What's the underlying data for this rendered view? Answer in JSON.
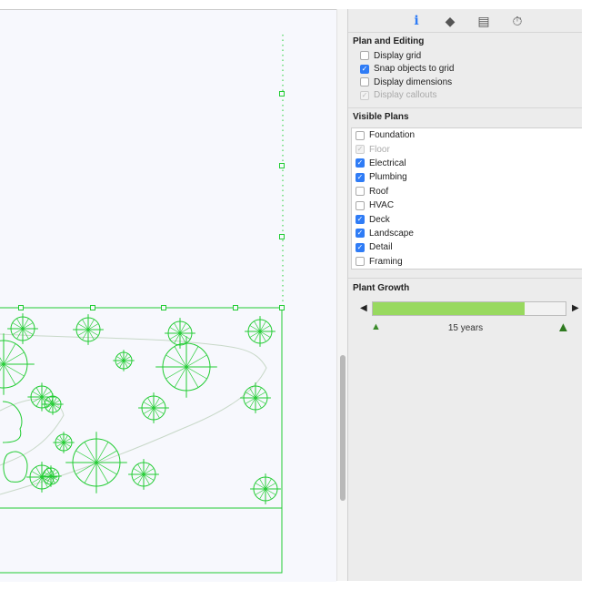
{
  "toolbar": {
    "icons": [
      "info-icon",
      "tag-icon",
      "chair-icon",
      "stopwatch-icon"
    ],
    "accent": "#2f7cf6"
  },
  "plan_editing": {
    "title": "Plan and Editing",
    "options": [
      {
        "label": "Display grid",
        "checked": false,
        "disabled": false
      },
      {
        "label": "Snap objects to grid",
        "checked": true,
        "disabled": false
      },
      {
        "label": "Display dimensions",
        "checked": false,
        "disabled": false
      },
      {
        "label": "Display callouts",
        "checked": true,
        "disabled": true
      }
    ]
  },
  "visible_plans": {
    "title": "Visible Plans",
    "items": [
      {
        "label": "Foundation",
        "checked": false,
        "disabled": false
      },
      {
        "label": "Floor",
        "checked": true,
        "disabled": true
      },
      {
        "label": "Electrical",
        "checked": true,
        "disabled": false
      },
      {
        "label": "Plumbing",
        "checked": true,
        "disabled": false
      },
      {
        "label": "Roof",
        "checked": false,
        "disabled": false
      },
      {
        "label": "HVAC",
        "checked": false,
        "disabled": false
      },
      {
        "label": "Deck",
        "checked": true,
        "disabled": false
      },
      {
        "label": "Landscape",
        "checked": true,
        "disabled": false
      },
      {
        "label": "Detail",
        "checked": true,
        "disabled": false
      },
      {
        "label": "Framing",
        "checked": false,
        "disabled": false
      }
    ]
  },
  "plant_growth": {
    "title": "Plant Growth",
    "label": "15 years",
    "progress": 0.79,
    "fill_color": "#98d95f"
  },
  "plan_color": "#22cc33"
}
